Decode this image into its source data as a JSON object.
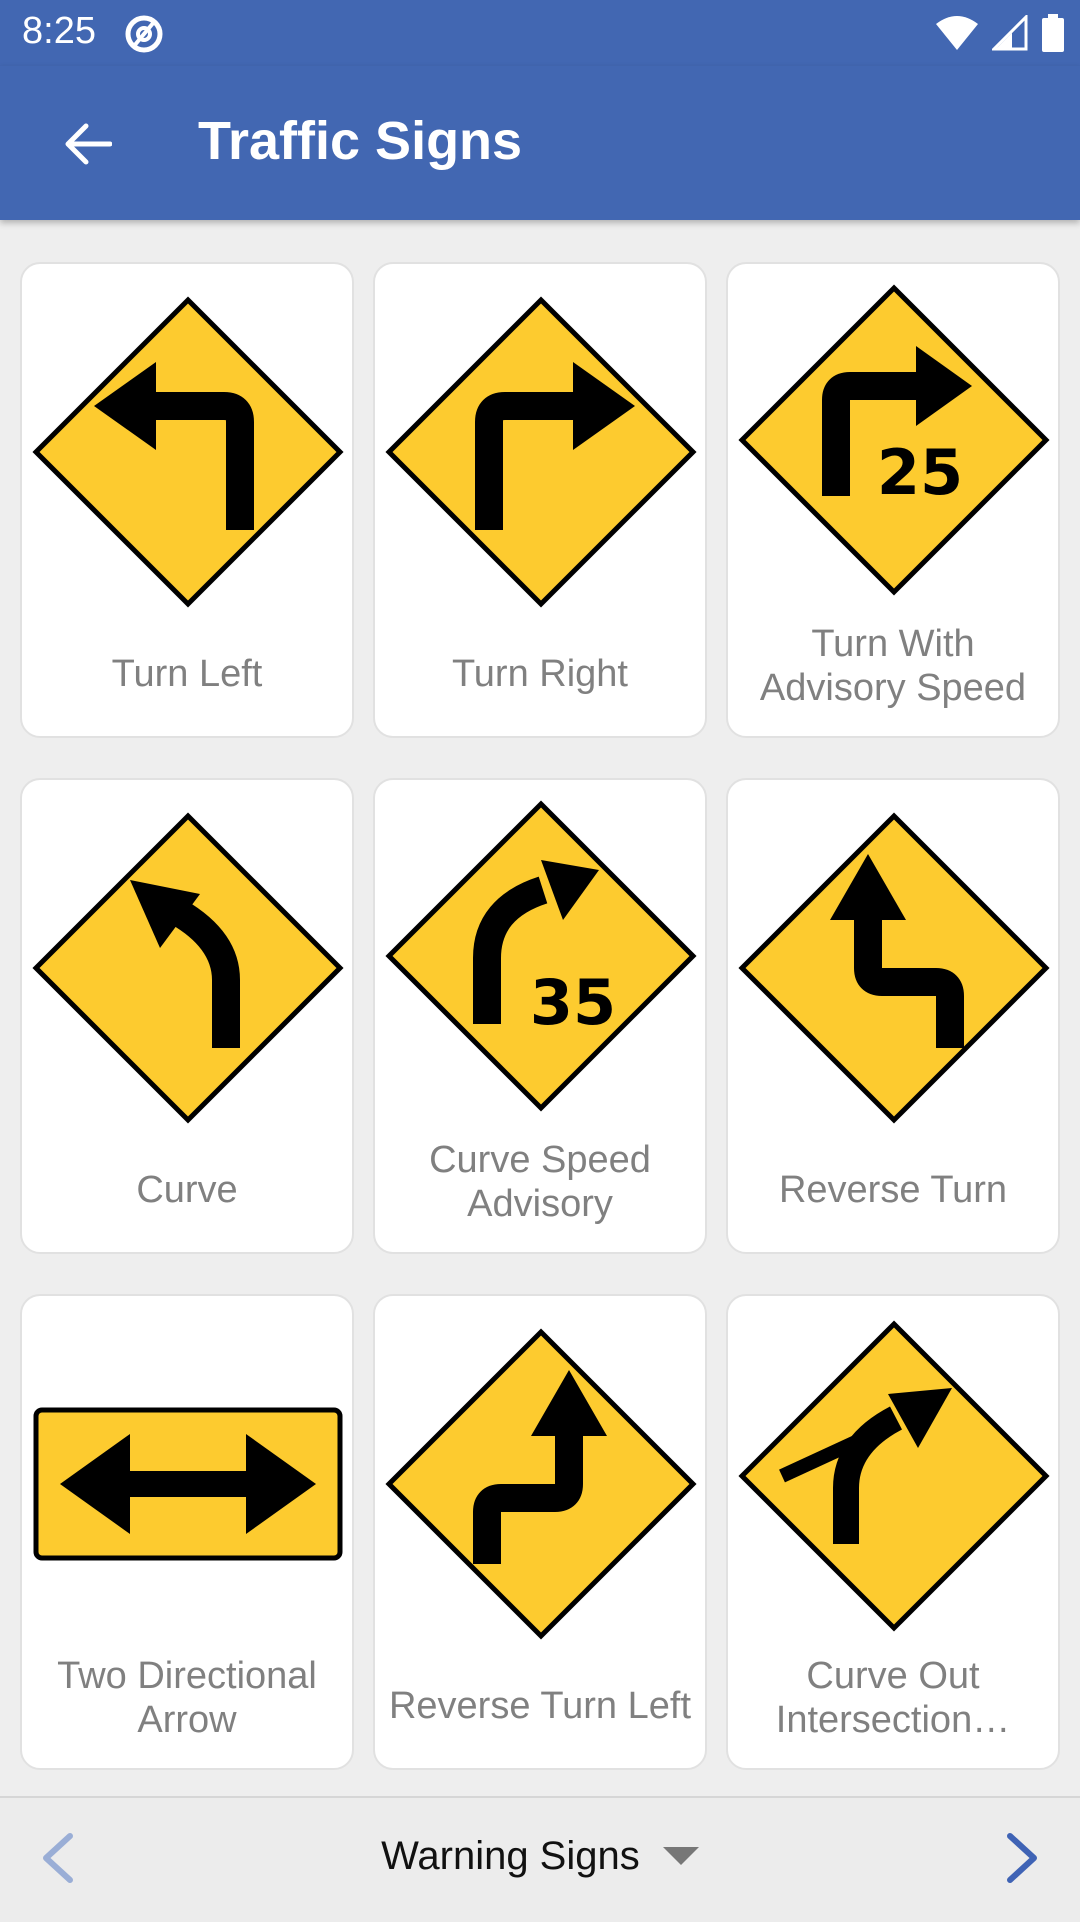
{
  "status": {
    "time": "8:25"
  },
  "header": {
    "title": "Traffic Signs"
  },
  "signs": [
    {
      "label": "Turn Left",
      "icon": "turn-left-sign"
    },
    {
      "label": "Turn Right",
      "icon": "turn-right-sign"
    },
    {
      "label": "Turn With Advisory Speed",
      "icon": "turn-advisory-speed-sign",
      "speed": "25"
    },
    {
      "label": "Curve",
      "icon": "curve-left-sign"
    },
    {
      "label": "Curve Speed Advisory",
      "icon": "curve-speed-advisory-sign",
      "speed": "35"
    },
    {
      "label": "Reverse Turn",
      "icon": "reverse-turn-sign"
    },
    {
      "label": "Two Directional Arrow",
      "icon": "two-directional-arrow-sign"
    },
    {
      "label": "Reverse Turn Left",
      "icon": "reverse-turn-left-sign"
    },
    {
      "label": "Curve Out Intersection…",
      "icon": "curve-out-intersection-sign"
    }
  ],
  "footer": {
    "category": "Warning Signs"
  },
  "colors": {
    "primary": "#4267b2",
    "sign_yellow": "#fdcb2f",
    "accent": "#3f63b5"
  }
}
